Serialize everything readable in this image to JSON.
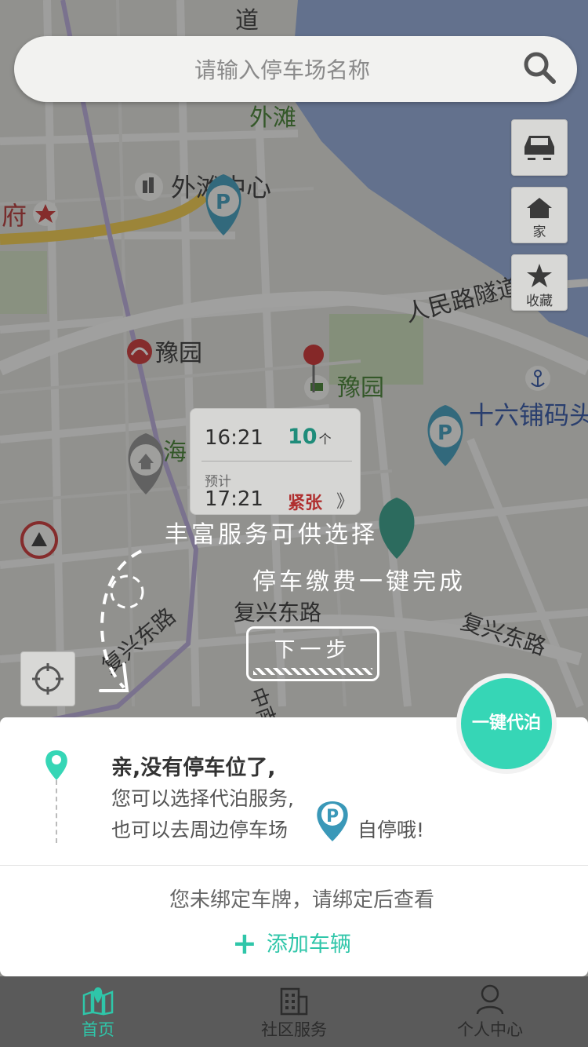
{
  "search": {
    "placeholder": "请输入停车场名称"
  },
  "side_buttons": {
    "car": "",
    "home": "家",
    "favorite": "收藏"
  },
  "map_labels": {
    "bund": "外滩",
    "bund_center": "外滩中心",
    "fu": "府",
    "renmin_tunnel": "人民路隧道",
    "yuyuan_metro": "豫园",
    "yuyuan": "豫园",
    "shiliupu": "十六铺码头",
    "hai": "海",
    "fuxing_e_rd_1": "复兴东路",
    "fuxing_e_rd_2": "复兴东路",
    "fuxing_e_rd_3": "复兴东路",
    "zhonghua_nan": "中南",
    "dao": "道"
  },
  "info_card": {
    "time": "16:21",
    "count": "10",
    "count_unit": "个",
    "forecast_label": "预计",
    "forecast_time": "17:21",
    "status": "紧张",
    "more": "》"
  },
  "guide": {
    "line1": "丰富服务可供选择",
    "line2": "停车缴费一键完成",
    "next_button": "下一步"
  },
  "valet_button": "一键代泊",
  "panel": {
    "title": "亲,没有停车位了,",
    "line2": "您可以选择代泊服务,",
    "line3": "也可以去周边停车场",
    "line3_suffix": "自停哦!",
    "notice": "您未绑定车牌，请绑定后查看",
    "add_vehicle": "添加车辆",
    "add_symbol": "+"
  },
  "tabs": [
    {
      "label": "首页",
      "icon": "home-map-icon",
      "active": true
    },
    {
      "label": "社区服务",
      "icon": "building-icon",
      "active": false
    },
    {
      "label": "个人中心",
      "icon": "person-icon",
      "active": false
    }
  ],
  "colors": {
    "accent": "#36d6b6",
    "tab_active": "#2fc6a9",
    "status_tight": "#b02f2f"
  }
}
